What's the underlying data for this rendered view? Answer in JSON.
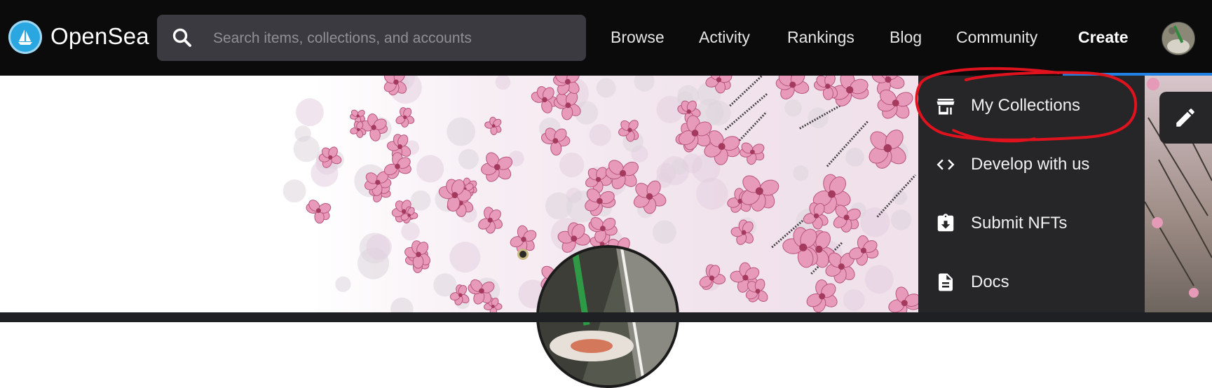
{
  "header": {
    "brand": "OpenSea",
    "logo_icon": "opensea-ship-icon",
    "search": {
      "placeholder": "Search items, collections, and accounts",
      "icon": "search-icon"
    },
    "nav": [
      {
        "label": "Browse"
      },
      {
        "label": "Activity"
      },
      {
        "label": "Rankings"
      },
      {
        "label": "Blog"
      },
      {
        "label": "Community"
      },
      {
        "label": "Create"
      }
    ],
    "avatar_icon": "user-avatar"
  },
  "dropdown": {
    "items": [
      {
        "label": "My Collections",
        "icon": "storefront-icon"
      },
      {
        "label": "Develop with us",
        "icon": "code-icon"
      },
      {
        "label": "Submit NFTs",
        "icon": "clipboard-download-icon"
      },
      {
        "label": "Docs",
        "icon": "document-icon"
      }
    ]
  },
  "edit_button": {
    "icon": "pencil-icon"
  },
  "colors": {
    "topbar": "#0b0b0c",
    "search_bg": "#3a3a40",
    "dropdown_bg": "#262629",
    "accent": "#2081e2",
    "annotation": "#e0121e",
    "blossom": "#e79ab9"
  }
}
